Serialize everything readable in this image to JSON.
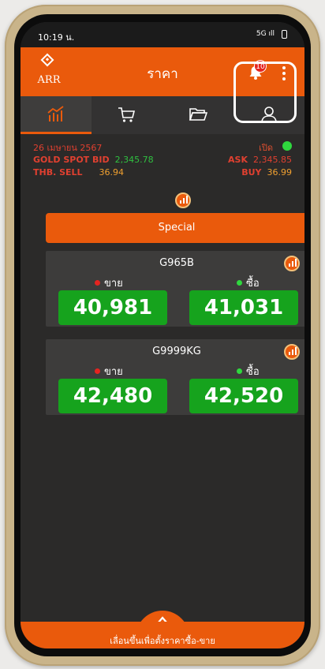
{
  "status_bar": {
    "time": "10:19 น.",
    "signal": "5G",
    "battery": "battery-icon"
  },
  "header": {
    "logo_text": "ARR",
    "logo_subtext": "",
    "title": "ราคา",
    "notification_count": "10"
  },
  "tabs": [
    {
      "icon": "price-chart-icon",
      "active": true
    },
    {
      "icon": "shopping-cart-icon",
      "active": false
    },
    {
      "icon": "folder-icon",
      "active": false
    },
    {
      "icon": "user-icon",
      "active": false
    }
  ],
  "market": {
    "date": "26 เมษายน 2567",
    "status": "เปิด",
    "gold_spot_bid_label": "GOLD SPOT BID",
    "gold_spot_bid_value": "2,345.78",
    "ask_label": "ASK",
    "ask_value": "2,345.85",
    "thb_sell_label": "THB. SELL",
    "thb_sell_value": "36.94",
    "buy_label": "BUY",
    "buy_value": "36.99"
  },
  "special_button": "Special",
  "products": [
    {
      "name": "G965B",
      "sell_label": "ขาย",
      "buy_label": "ซื้อ",
      "sell_price": "40,981",
      "buy_price": "41,031"
    },
    {
      "name": "G9999KG",
      "sell_label": "ขาย",
      "buy_label": "ซื้อ",
      "sell_price": "42,480",
      "buy_price": "42,520"
    }
  ],
  "bottom_bar": {
    "text": "เลื่อนขึ้นเพื่อตั้งราคาซื้อ-ขาย"
  },
  "colors": {
    "brand": "#ea5a0c",
    "price_green": "#16a31d",
    "background": "#2b2a29"
  }
}
